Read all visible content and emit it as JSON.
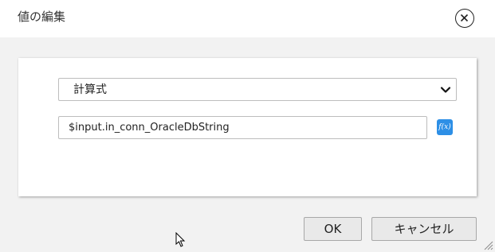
{
  "dialog": {
    "title": "値の編集",
    "close_icon": "close-circle-icon"
  },
  "form": {
    "type_select": {
      "selected": "計算式",
      "icon": "chevron-down-icon"
    },
    "expression_input": {
      "value": "$input.in_conn_OracleDbString"
    },
    "function_button": {
      "label": "f(x)",
      "color": "#2d8fe6"
    }
  },
  "footer": {
    "ok_label": "OK",
    "cancel_label": "キャンセル"
  }
}
